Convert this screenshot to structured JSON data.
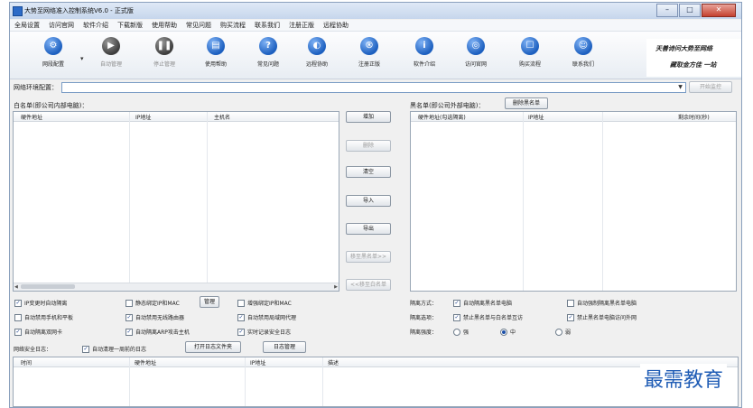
{
  "window": {
    "title": "大势至网络准入控制系统V6.0 - 正式版"
  },
  "menu": [
    "全局设置",
    "访问官网",
    "软件介绍",
    "下载新版",
    "使用帮助",
    "常见问题",
    "购买流程",
    "联系我们",
    "注册正版",
    "远程协助"
  ],
  "toolbar": {
    "buttons": [
      {
        "label": "网段配置",
        "icon": "settings-icon",
        "enabled": true
      },
      {
        "label": "自动管理",
        "icon": "play-icon",
        "enabled": false
      },
      {
        "label": "停止管理",
        "icon": "pause-icon",
        "enabled": false
      },
      {
        "label": "使用帮助",
        "icon": "book-icon",
        "enabled": true
      },
      {
        "label": "常见问题",
        "icon": "question-icon",
        "enabled": true
      },
      {
        "label": "远程协助",
        "icon": "remote-icon",
        "enabled": true
      },
      {
        "label": "注册正版",
        "icon": "register-icon",
        "enabled": true
      },
      {
        "label": "软件介绍",
        "icon": "info-icon",
        "enabled": true
      },
      {
        "label": "访问官网",
        "icon": "globe-icon",
        "enabled": true
      },
      {
        "label": "购买流程",
        "icon": "cart-icon",
        "enabled": true
      },
      {
        "label": "联系我们",
        "icon": "contact-icon",
        "enabled": true
      }
    ],
    "calligraphy": {
      "line1": "天善诗问大势至网络",
      "line2": "藏取金方佳 一站"
    }
  },
  "network": {
    "label": "网络环境配置：",
    "value": "",
    "start_button": "开始监控"
  },
  "whitelist": {
    "label": "白名单(即公司内部电脑)：",
    "columns": [
      "硬件地址",
      "IP地址",
      "主机名"
    ]
  },
  "blacklist": {
    "label": "黑名单(即公司外部电脑)：",
    "delete_button": "删除黑名单",
    "columns": [
      "硬件地址(勾选隔离)",
      "IP地址",
      "剩余时间(秒)"
    ]
  },
  "middle_buttons": [
    {
      "label": "增加",
      "enabled": true
    },
    {
      "label": "删除",
      "enabled": false
    },
    {
      "label": "清空",
      "enabled": true
    },
    {
      "label": "导入",
      "enabled": true
    },
    {
      "label": "导出",
      "enabled": true
    },
    {
      "label": "移至黑名单>>",
      "enabled": false
    },
    {
      "label": "<<移至白名单",
      "enabled": false
    }
  ],
  "options": {
    "ip_change_isolate": {
      "label": "IP变更时自动隔离",
      "checked": true
    },
    "static_bind": {
      "label": "静态绑定IP和MAC",
      "checked": false
    },
    "manage_button": "管理",
    "enhanced_bind": {
      "label": "增强绑定IP和MAC",
      "checked": false
    },
    "auto_disable_phone": {
      "label": "自动禁用手机和平板",
      "checked": false
    },
    "auto_disable_wireless": {
      "label": "自动禁用无线路由器",
      "checked": true
    },
    "auto_disable_proxy": {
      "label": "自动禁用局域网代理",
      "checked": true
    },
    "auto_isolate_dual_nic": {
      "label": "自动隔离双网卡",
      "checked": true
    },
    "auto_isolate_arp": {
      "label": "自动隔离ARP攻击主机",
      "checked": true
    },
    "realtime_log": {
      "label": "实时记录安全日志",
      "checked": true
    }
  },
  "isolation": {
    "mode_label": "隔离方式：",
    "mode_auto_black": {
      "label": "自动隔离黑名单电脑",
      "checked": true
    },
    "mode_force_black": {
      "label": "自动强制隔离黑名单电脑",
      "checked": false
    },
    "select_label": "隔离选项：",
    "select_block_interact": {
      "label": "禁止黑名单与白名单互访",
      "checked": true
    },
    "select_block_internet": {
      "label": "禁止黑名单电脑访问外网",
      "checked": true
    },
    "strength_label": "隔离强度：",
    "strength_options": [
      "强",
      "中",
      "弱"
    ],
    "strength_selected": "中"
  },
  "log": {
    "label": "网络安全日志：",
    "auto_clean": {
      "label": "自动清理一周前的日志",
      "checked": true
    },
    "open_folder_button": "打开日志文件夹",
    "manage_button": "日志管理",
    "columns": [
      "时间",
      "硬件地址",
      "IP地址",
      "描述"
    ]
  },
  "watermark": "最需教育",
  "colors": {
    "accent": "#1c5fbf",
    "icon_disabled": "#3d3d3d",
    "border": "#9aa7b6"
  }
}
